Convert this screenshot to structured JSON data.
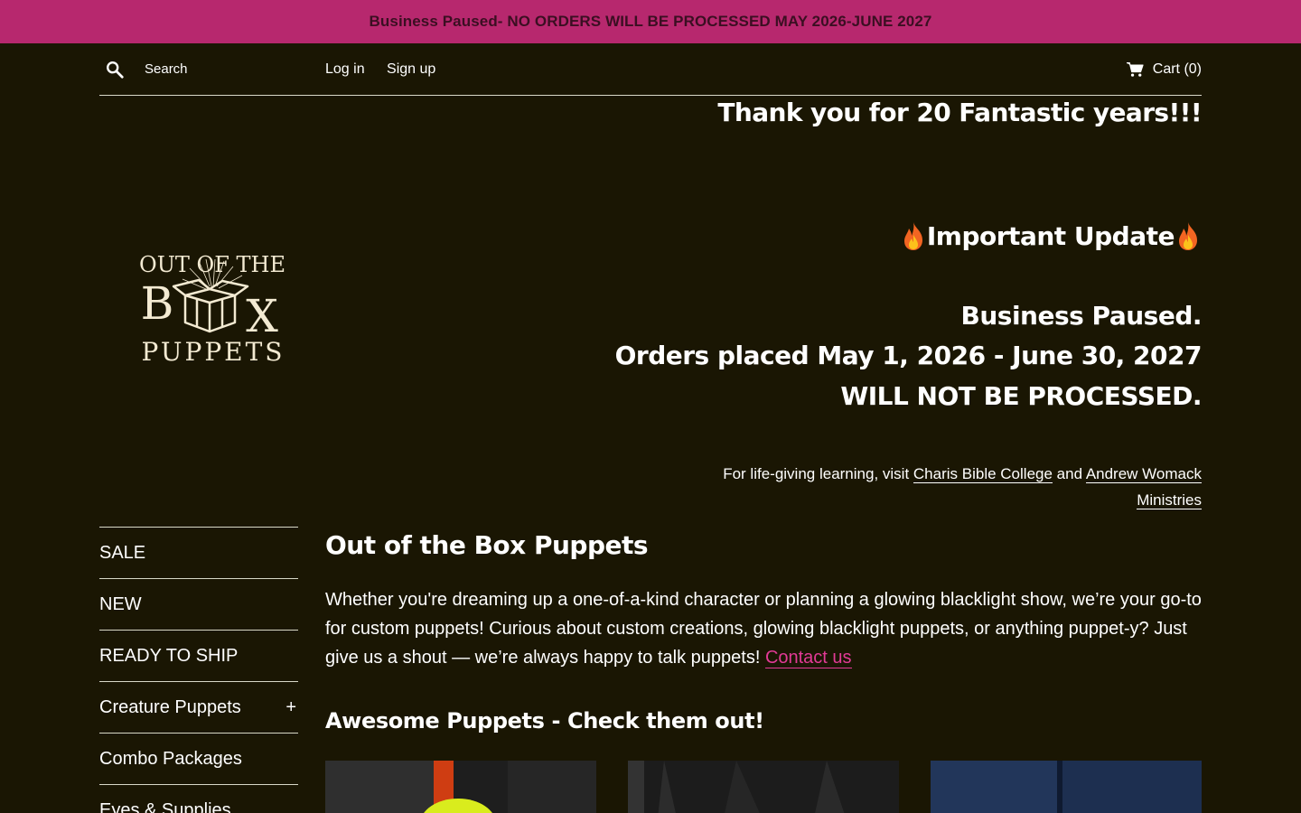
{
  "announcement": "Business Paused- NO ORDERS WILL BE PROCESSED MAY 2026-JUNE 2027",
  "header": {
    "search_placeholder": "Search",
    "login": "Log in",
    "signup": "Sign up",
    "cart": "Cart (0)"
  },
  "thanks": "Thank you for 20 Fantastic years!!!",
  "logo": {
    "line1": "OUT OF THE",
    "line2a": "B",
    "line2b": "X",
    "line3": "PUPPETS"
  },
  "update": {
    "title": "Important Update",
    "line1": "Business Paused.",
    "line2": "Orders placed May 1, 2026 - June 30, 2027",
    "line3": "WILL NOT BE PROCESSED."
  },
  "learning": {
    "prefix": "For life-giving learning, visit ",
    "link1": "Charis Bible College",
    "mid": " and ",
    "link2": "Andrew Womack Ministries"
  },
  "sidebar": {
    "items": [
      {
        "label": "SALE",
        "expandable": false
      },
      {
        "label": "NEW",
        "expandable": false
      },
      {
        "label": "READY TO SHIP",
        "expandable": false
      },
      {
        "label": "Creature Puppets",
        "expandable": true
      },
      {
        "label": "Combo Packages",
        "expandable": false
      },
      {
        "label": "Eyes & Supplies",
        "expandable": false
      }
    ]
  },
  "main": {
    "title": "Out of the Box Puppets",
    "body": "Whether you're dreaming up a one-of-a-kind character or planning a glowing blacklight show, we’re your go-to for custom puppets! Curious about custom creations, glowing blacklight puppets, or anything puppet-y? Just give us a shout — we’re always happy to talk puppets! ",
    "contact": "Contact us",
    "subtitle": "Awesome Puppets - Check them out!"
  },
  "colors": {
    "background": "#1a1603",
    "announcement_bg": "#b7286e",
    "link_pink": "#e23a96"
  }
}
